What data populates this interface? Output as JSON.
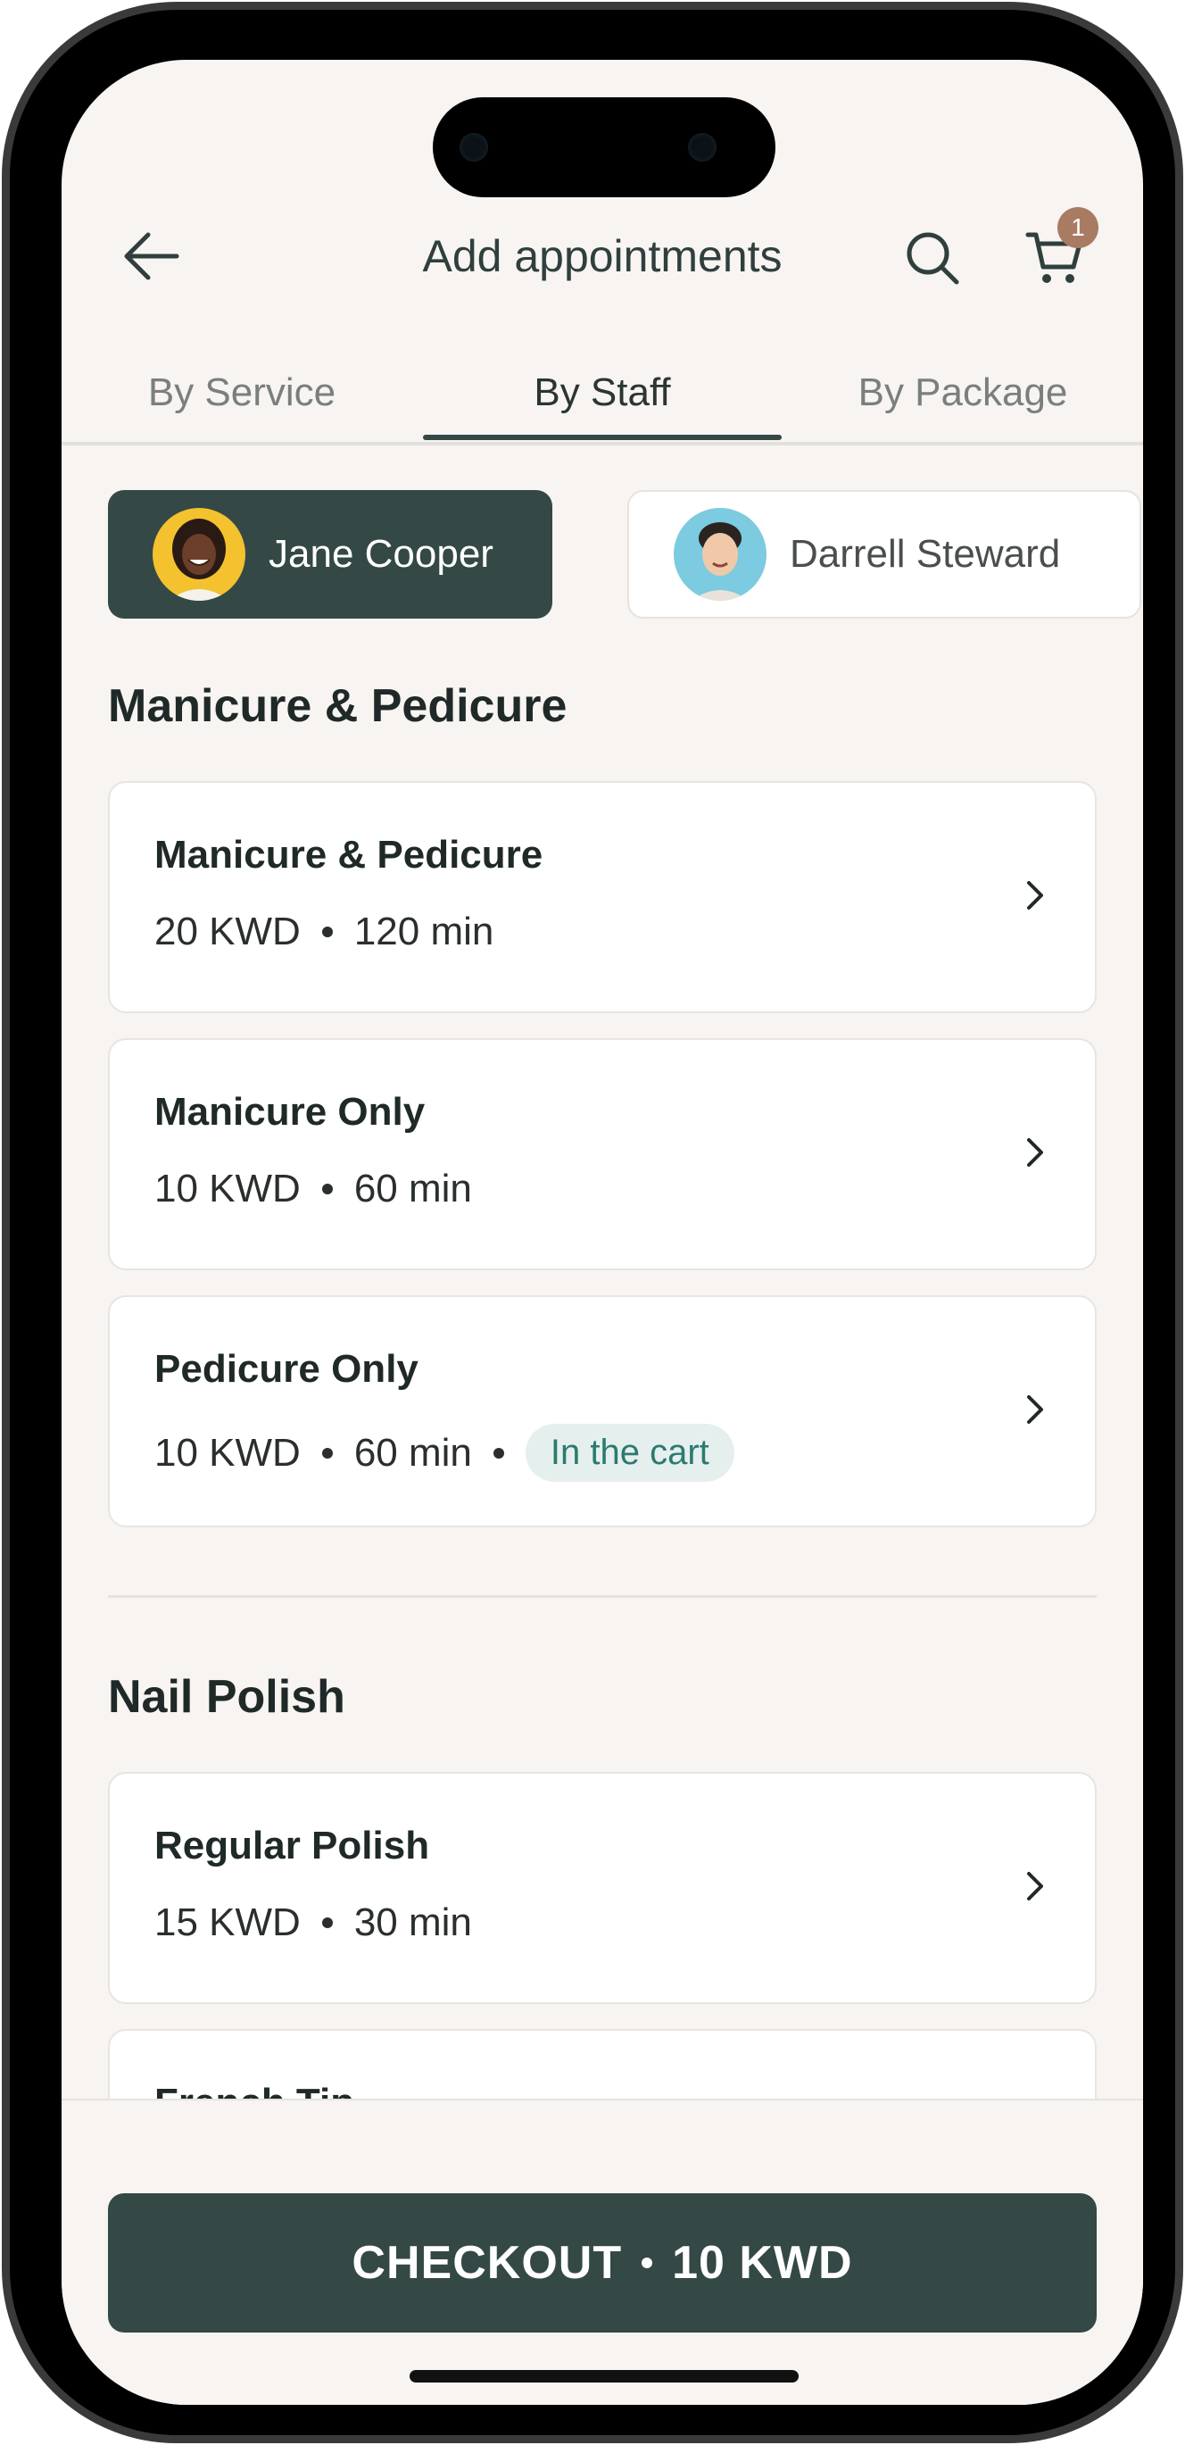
{
  "header": {
    "title": "Add appointments",
    "cart_count": "1"
  },
  "tabs": [
    {
      "label": "By Service"
    },
    {
      "label": "By Staff"
    },
    {
      "label": "By Package"
    }
  ],
  "staff": [
    {
      "name": "Jane Cooper"
    },
    {
      "name": "Darrell Steward"
    }
  ],
  "sections": [
    {
      "title": "Manicure & Pedicure",
      "services": [
        {
          "name": "Manicure & Pedicure",
          "price": "20 KWD",
          "duration": "120 min"
        },
        {
          "name": "Manicure Only",
          "price": "10 KWD",
          "duration": "60 min"
        },
        {
          "name": "Pedicure Only",
          "price": "10 KWD",
          "duration": "60 min",
          "status": "In the cart"
        }
      ]
    },
    {
      "title": "Nail Polish",
      "services": [
        {
          "name": "Regular Polish",
          "price": "15 KWD",
          "duration": "30 min"
        },
        {
          "name": "French Tip"
        }
      ]
    }
  ],
  "checkout": {
    "label": "CHECKOUT",
    "total": "10 KWD"
  },
  "colors": {
    "primary": "#344846",
    "background": "#f7f4f1",
    "badge": "#a97b63",
    "cart_tag_bg": "#e5efee",
    "cart_tag_text": "#2c7a70"
  }
}
